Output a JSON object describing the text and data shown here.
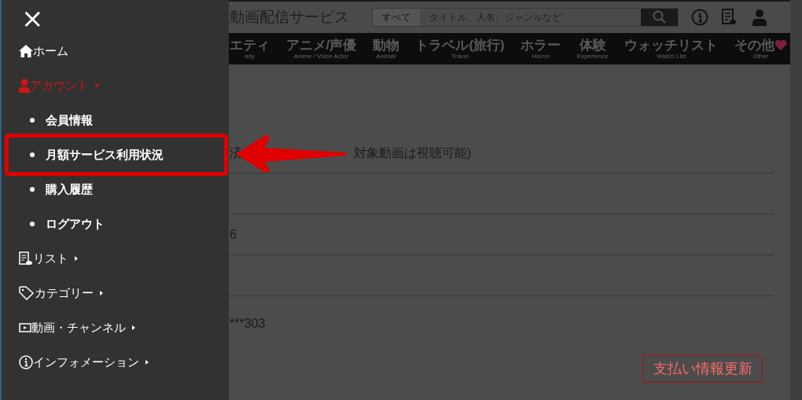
{
  "page": {
    "title": "動画配信サービス",
    "search": {
      "scope": "すべて",
      "placeholder": "タイトル、人名、ジャンルなど"
    },
    "nav": [
      {
        "label": "エティ",
        "sub": "iety"
      },
      {
        "label": "アニメ/声優",
        "sub": "Anime / Voice Actor"
      },
      {
        "label": "動物",
        "sub": "Animal"
      },
      {
        "label": "トラベル(旅行)",
        "sub": "Travel"
      },
      {
        "label": "ホラー",
        "sub": "Horror"
      },
      {
        "label": "体験",
        "sub": "Experience"
      },
      {
        "label": "ウォッチリスト",
        "sub": "Watch List"
      },
      {
        "label": "その他",
        "sub": "Other"
      }
    ],
    "rows": [
      {
        "kind": "text",
        "parts": [
          "済",
          "対象動画は視聴可能)"
        ]
      },
      {
        "kind": "blank"
      },
      {
        "kind": "text",
        "parts": [
          "6"
        ]
      },
      {
        "kind": "blank"
      },
      {
        "kind": "text",
        "parts": [
          "***303"
        ]
      }
    ],
    "button": "支払い情報更新"
  },
  "drawer": {
    "close": "×",
    "items": [
      {
        "label": "ホーム",
        "kind": "link"
      },
      {
        "label": "アカウント",
        "kind": "group",
        "expanded": true,
        "children": [
          {
            "label": "会員情報",
            "highlighted": false
          },
          {
            "label": "月額サービス利用状況",
            "highlighted": true
          },
          {
            "label": "購入履歴",
            "highlighted": false
          },
          {
            "label": "ログアウト",
            "highlighted": false
          }
        ]
      },
      {
        "label": "リスト",
        "kind": "group",
        "expanded": false
      },
      {
        "label": "カテゴリー",
        "kind": "group",
        "expanded": false
      },
      {
        "label": "動画・チャンネル",
        "kind": "group",
        "expanded": false
      },
      {
        "label": "インフォメーション",
        "kind": "group",
        "expanded": false
      }
    ]
  }
}
